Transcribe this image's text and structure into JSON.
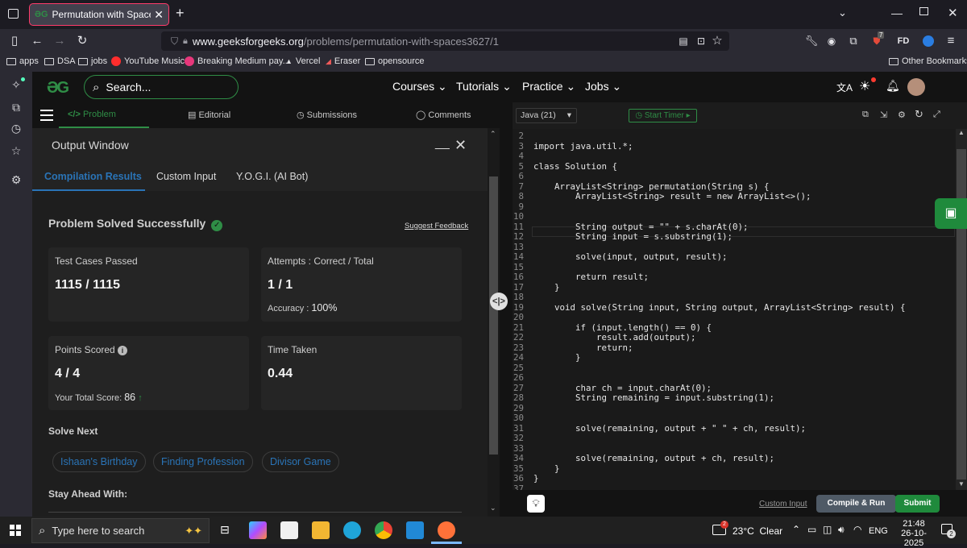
{
  "browser": {
    "tab_title": "Permutation with Spaces | Practi",
    "tab_favicon": "gfg",
    "url_host": "www.geeksforgeeks.org",
    "url_path": "/problems/permutation-with-spaces3627/1",
    "extension_badge": "7",
    "profile_label": "FD",
    "bookmarks": [
      "apps",
      "DSA",
      "jobs",
      "YouTube Music",
      "Breaking Medium pay...",
      "Vercel",
      "Eraser",
      "opensource"
    ],
    "other_bookmarks": "Other Bookmarks"
  },
  "gfg": {
    "search_placeholder": "Search...",
    "nav": [
      "Courses",
      "Tutorials",
      "Practice",
      "Jobs"
    ]
  },
  "problem_tabs": [
    "Problem",
    "Editorial",
    "Submissions",
    "Comments"
  ],
  "output_window": {
    "title": "Output Window",
    "tabs": [
      "Compilation Results",
      "Custom Input",
      "Y.O.G.I. (AI Bot)"
    ],
    "status": "Problem Solved Successfully",
    "suggest_feedback": "Suggest Feedback",
    "test_cases_label": "Test Cases Passed",
    "test_cases_value": "1115 / 1115",
    "attempts_label": "Attempts : Correct / Total",
    "attempts_value": "1 / 1",
    "accuracy_label": "Accuracy :",
    "accuracy_value": "100%",
    "points_label": "Points Scored",
    "points_value": "4 / 4",
    "total_score_label": "Your Total Score:",
    "total_score_value": "86",
    "time_label": "Time Taken",
    "time_value": "0.44",
    "solve_next_title": "Solve Next",
    "solve_next": [
      "Ishaan's Birthday",
      "Finding Profession",
      "Divisor Game"
    ],
    "stay_ahead": "Stay Ahead With:"
  },
  "editor": {
    "language": "Java (21)",
    "timer_label": "Start Timer",
    "custom_input": "Custom Input",
    "compile_run": "Compile & Run",
    "submit": "Submit",
    "lines": [
      {
        "n": "2",
        "code": ""
      },
      {
        "n": "3",
        "code": "import java.util.*;"
      },
      {
        "n": "4",
        "code": ""
      },
      {
        "n": "5",
        "code": "class Solution {"
      },
      {
        "n": "6",
        "code": ""
      },
      {
        "n": "7",
        "code": "    ArrayList<String> permutation(String s) {"
      },
      {
        "n": "8",
        "code": "        ArrayList<String> result = new ArrayList<>();"
      },
      {
        "n": "9",
        "code": ""
      },
      {
        "n": "10",
        "code": ""
      },
      {
        "n": "11",
        "code": "        String output = \"\" + s.charAt(0);"
      },
      {
        "n": "12",
        "code": "        String input = s.substring(1);"
      },
      {
        "n": "13",
        "code": ""
      },
      {
        "n": "14",
        "code": "        solve(input, output, result);"
      },
      {
        "n": "15",
        "code": ""
      },
      {
        "n": "16",
        "code": "        return result;"
      },
      {
        "n": "17",
        "code": "    }"
      },
      {
        "n": "18",
        "code": ""
      },
      {
        "n": "19",
        "code": "    void solve(String input, String output, ArrayList<String> result) {"
      },
      {
        "n": "20",
        "code": ""
      },
      {
        "n": "21",
        "code": "        if (input.length() == 0) {"
      },
      {
        "n": "22",
        "code": "            result.add(output);"
      },
      {
        "n": "23",
        "code": "            return;"
      },
      {
        "n": "24",
        "code": "        }"
      },
      {
        "n": "25",
        "code": ""
      },
      {
        "n": "26",
        "code": ""
      },
      {
        "n": "27",
        "code": "        char ch = input.charAt(0);"
      },
      {
        "n": "28",
        "code": "        String remaining = input.substring(1);"
      },
      {
        "n": "29",
        "code": ""
      },
      {
        "n": "30",
        "code": ""
      },
      {
        "n": "31",
        "code": "        solve(remaining, output + \" \" + ch, result);"
      },
      {
        "n": "32",
        "code": ""
      },
      {
        "n": "33",
        "code": ""
      },
      {
        "n": "34",
        "code": "        solve(remaining, output + ch, result);"
      },
      {
        "n": "35",
        "code": "    }"
      },
      {
        "n": "36",
        "code": "}"
      },
      {
        "n": "37",
        "code": ""
      }
    ]
  },
  "taskbar": {
    "search_placeholder": "Type here to search",
    "weather": "23°C  Clear",
    "weather_badge": "2",
    "language": "ENG",
    "time": "21:48",
    "date": "26-10-2025",
    "notification_count": "2"
  },
  "colors": {
    "gfg_green": "#2f8d46",
    "link_blue": "#2a74b7",
    "submit_green": "#1f8a3c",
    "compile_gray": "#4f5a66"
  }
}
